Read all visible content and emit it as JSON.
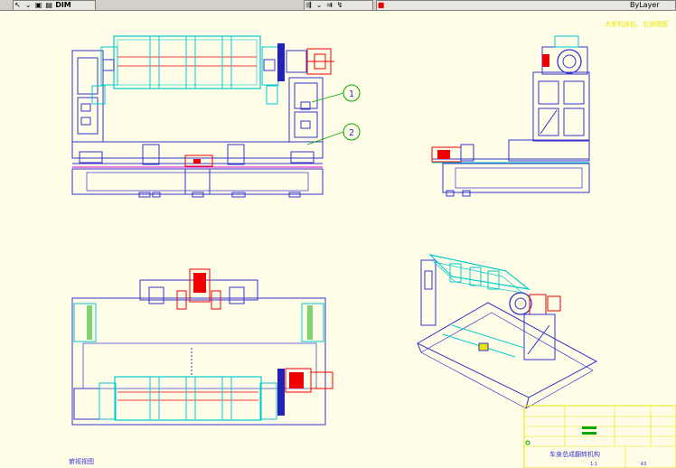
{
  "toolbar": {
    "combo_text": "DIM",
    "right_text": "ByLayer"
  },
  "drawing": {
    "top_right_note": "大型机床机、右侧视图",
    "bottom_left_note": "俯视视图",
    "balloon_1": "1",
    "balloon_2": "2"
  },
  "title_block": {
    "drawing_title": "车身总成翻转机构",
    "scale_label": "1:1",
    "sheet_label": "A3"
  },
  "colors": {
    "background": "#fffde8",
    "frame_blue": "#3333cc",
    "cyan": "#00cccc",
    "red": "#ee0000",
    "green": "#00aa00",
    "magenta": "#cc00cc",
    "yellow": "#e6e600"
  }
}
